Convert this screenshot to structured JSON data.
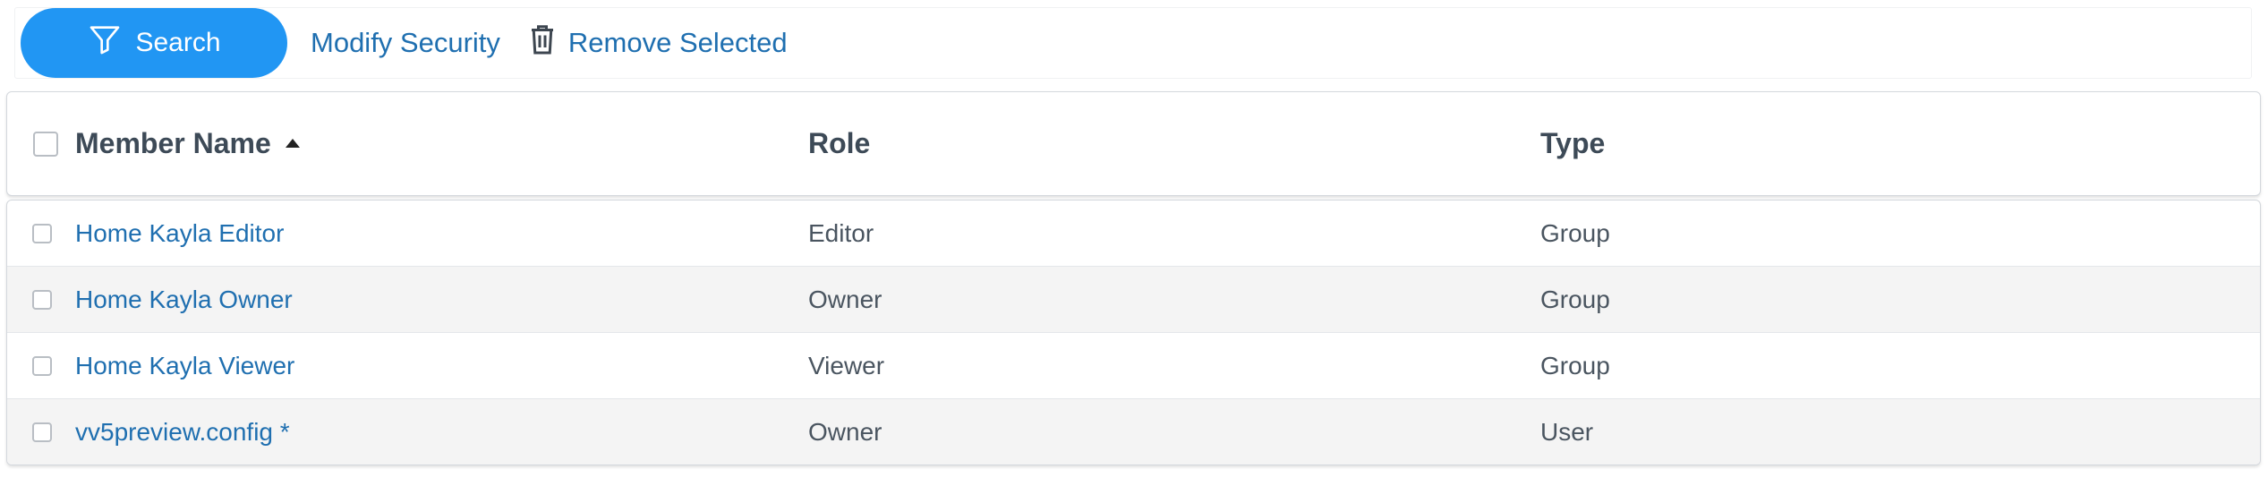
{
  "toolbar": {
    "search_label": "Search",
    "search_icon": "filter-icon",
    "modify_label": "Modify Security",
    "remove_label": "Remove Selected",
    "remove_icon": "trash-icon",
    "accent_color": "#2196f3",
    "link_color": "#1f6fb0"
  },
  "table": {
    "columns": [
      {
        "label": "Member Name",
        "sorted": "ascending"
      },
      {
        "label": "Role"
      },
      {
        "label": "Type"
      }
    ],
    "rows": [
      {
        "name": "Home Kayla Editor",
        "role": "Editor",
        "type": "Group",
        "checked": false
      },
      {
        "name": "Home Kayla Owner",
        "role": "Owner",
        "type": "Group",
        "checked": false
      },
      {
        "name": "Home Kayla Viewer",
        "role": "Viewer",
        "type": "Group",
        "checked": false
      },
      {
        "name": "vv5preview.config *",
        "role": "Owner",
        "type": "User",
        "checked": false
      }
    ]
  }
}
